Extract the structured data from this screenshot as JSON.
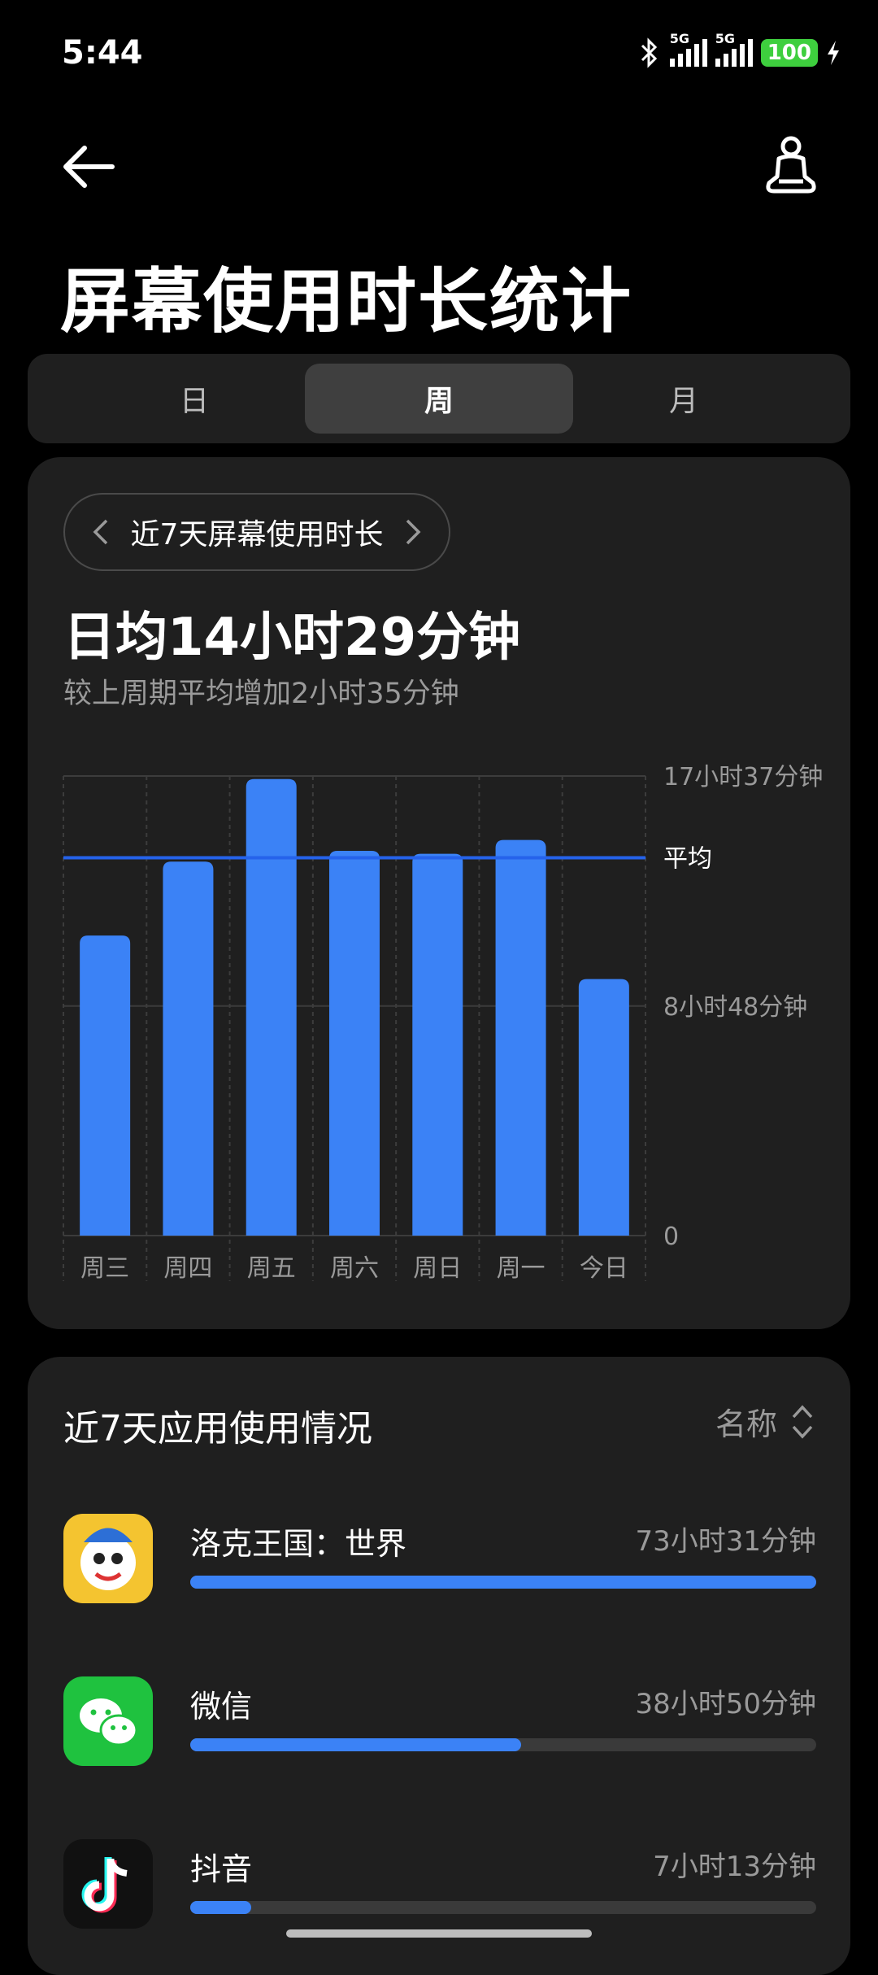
{
  "status_bar": {
    "time": "5:44",
    "net1": "5G",
    "net2": "5G",
    "battery": "100"
  },
  "header": {
    "title": "屏幕使用时长统计"
  },
  "tabs": [
    {
      "label": "日"
    },
    {
      "label": "周",
      "selected": true
    },
    {
      "label": "月"
    }
  ],
  "summary": {
    "range_label": "近7天屏幕使用时长",
    "daily_avg": "日均14小时29分钟",
    "compare": "较上周期平均增加2小时35分钟"
  },
  "chart_data": {
    "type": "bar",
    "categories": [
      "周三",
      "周四",
      "周五",
      "周六",
      "周日",
      "周一",
      "今日"
    ],
    "values_minutes": [
      690,
      860,
      1050,
      885,
      878,
      910,
      590
    ],
    "y_ticks": [
      {
        "value": 1057,
        "label": "17小时37分钟"
      },
      {
        "value": 528,
        "label": "8小时48分钟"
      },
      {
        "value": 0,
        "label": "0"
      }
    ],
    "average_minutes": 869,
    "average_label": "平均",
    "ylim": [
      0,
      1057
    ],
    "bar_color": "#3b82f6",
    "avg_line_color": "#2563eb"
  },
  "apps_section": {
    "title": "近7天应用使用情况",
    "sort_label": "名称",
    "apps": [
      {
        "name": "洛克王国：世界",
        "time": "73小时31分钟",
        "fraction": 1.0,
        "icon": "roco-kingdom-icon"
      },
      {
        "name": "微信",
        "time": "38小时50分钟",
        "fraction": 0.528,
        "icon": "wechat-icon"
      },
      {
        "name": "抖音",
        "time": "7小时13分钟",
        "fraction": 0.098,
        "icon": "douyin-icon"
      }
    ]
  }
}
